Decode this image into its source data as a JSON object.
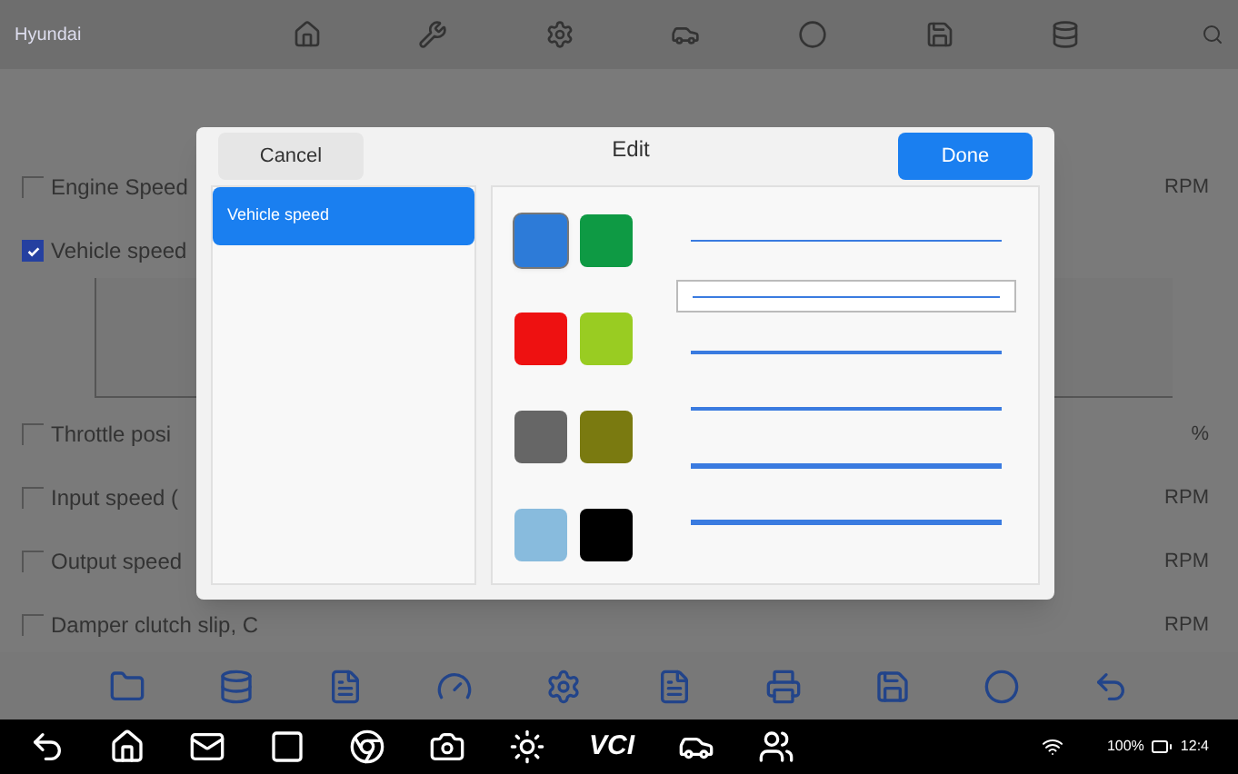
{
  "header": {
    "title": "Hyundai"
  },
  "rows": [
    {
      "label": "Engine Speed",
      "checked": false,
      "unit": "RPM",
      "kind": "plain"
    },
    {
      "label": "Vehicle speed",
      "checked": true,
      "unit": "",
      "kind": "graph"
    },
    {
      "label": "Throttle posi",
      "checked": false,
      "unit": "%",
      "kind": "plain"
    },
    {
      "label": "Input speed (",
      "checked": false,
      "unit": "RPM",
      "kind": "plain"
    },
    {
      "label": "Output speed",
      "checked": false,
      "unit": "RPM",
      "kind": "plain"
    },
    {
      "label": "Damper clutch slip, C",
      "checked": false,
      "unit": "RPM",
      "kind": "plain"
    }
  ],
  "dialog": {
    "title": "Edit",
    "cancel": "Cancel",
    "done": "Done",
    "items": [
      {
        "label": "Vehicle speed",
        "selected": true
      }
    ],
    "colors": [
      {
        "color": "#2d7bd8",
        "selected": true
      },
      {
        "color": "#0e9a44",
        "selected": false
      },
      {
        "color": "#ee1111",
        "selected": false
      },
      {
        "color": "#99cc22",
        "selected": false
      },
      {
        "color": "#666666",
        "selected": false
      },
      {
        "color": "#7a7a10",
        "selected": false
      },
      {
        "color": "#88bbdd",
        "selected": false
      },
      {
        "color": "#000000",
        "selected": false
      }
    ],
    "line_styles": [
      {
        "selected": false
      },
      {
        "selected": true
      },
      {
        "selected": false
      },
      {
        "selected": false
      },
      {
        "selected": false
      },
      {
        "selected": false
      }
    ]
  },
  "navbar": {
    "vci": "VCI",
    "battery": "100%",
    "time": "12:4"
  }
}
